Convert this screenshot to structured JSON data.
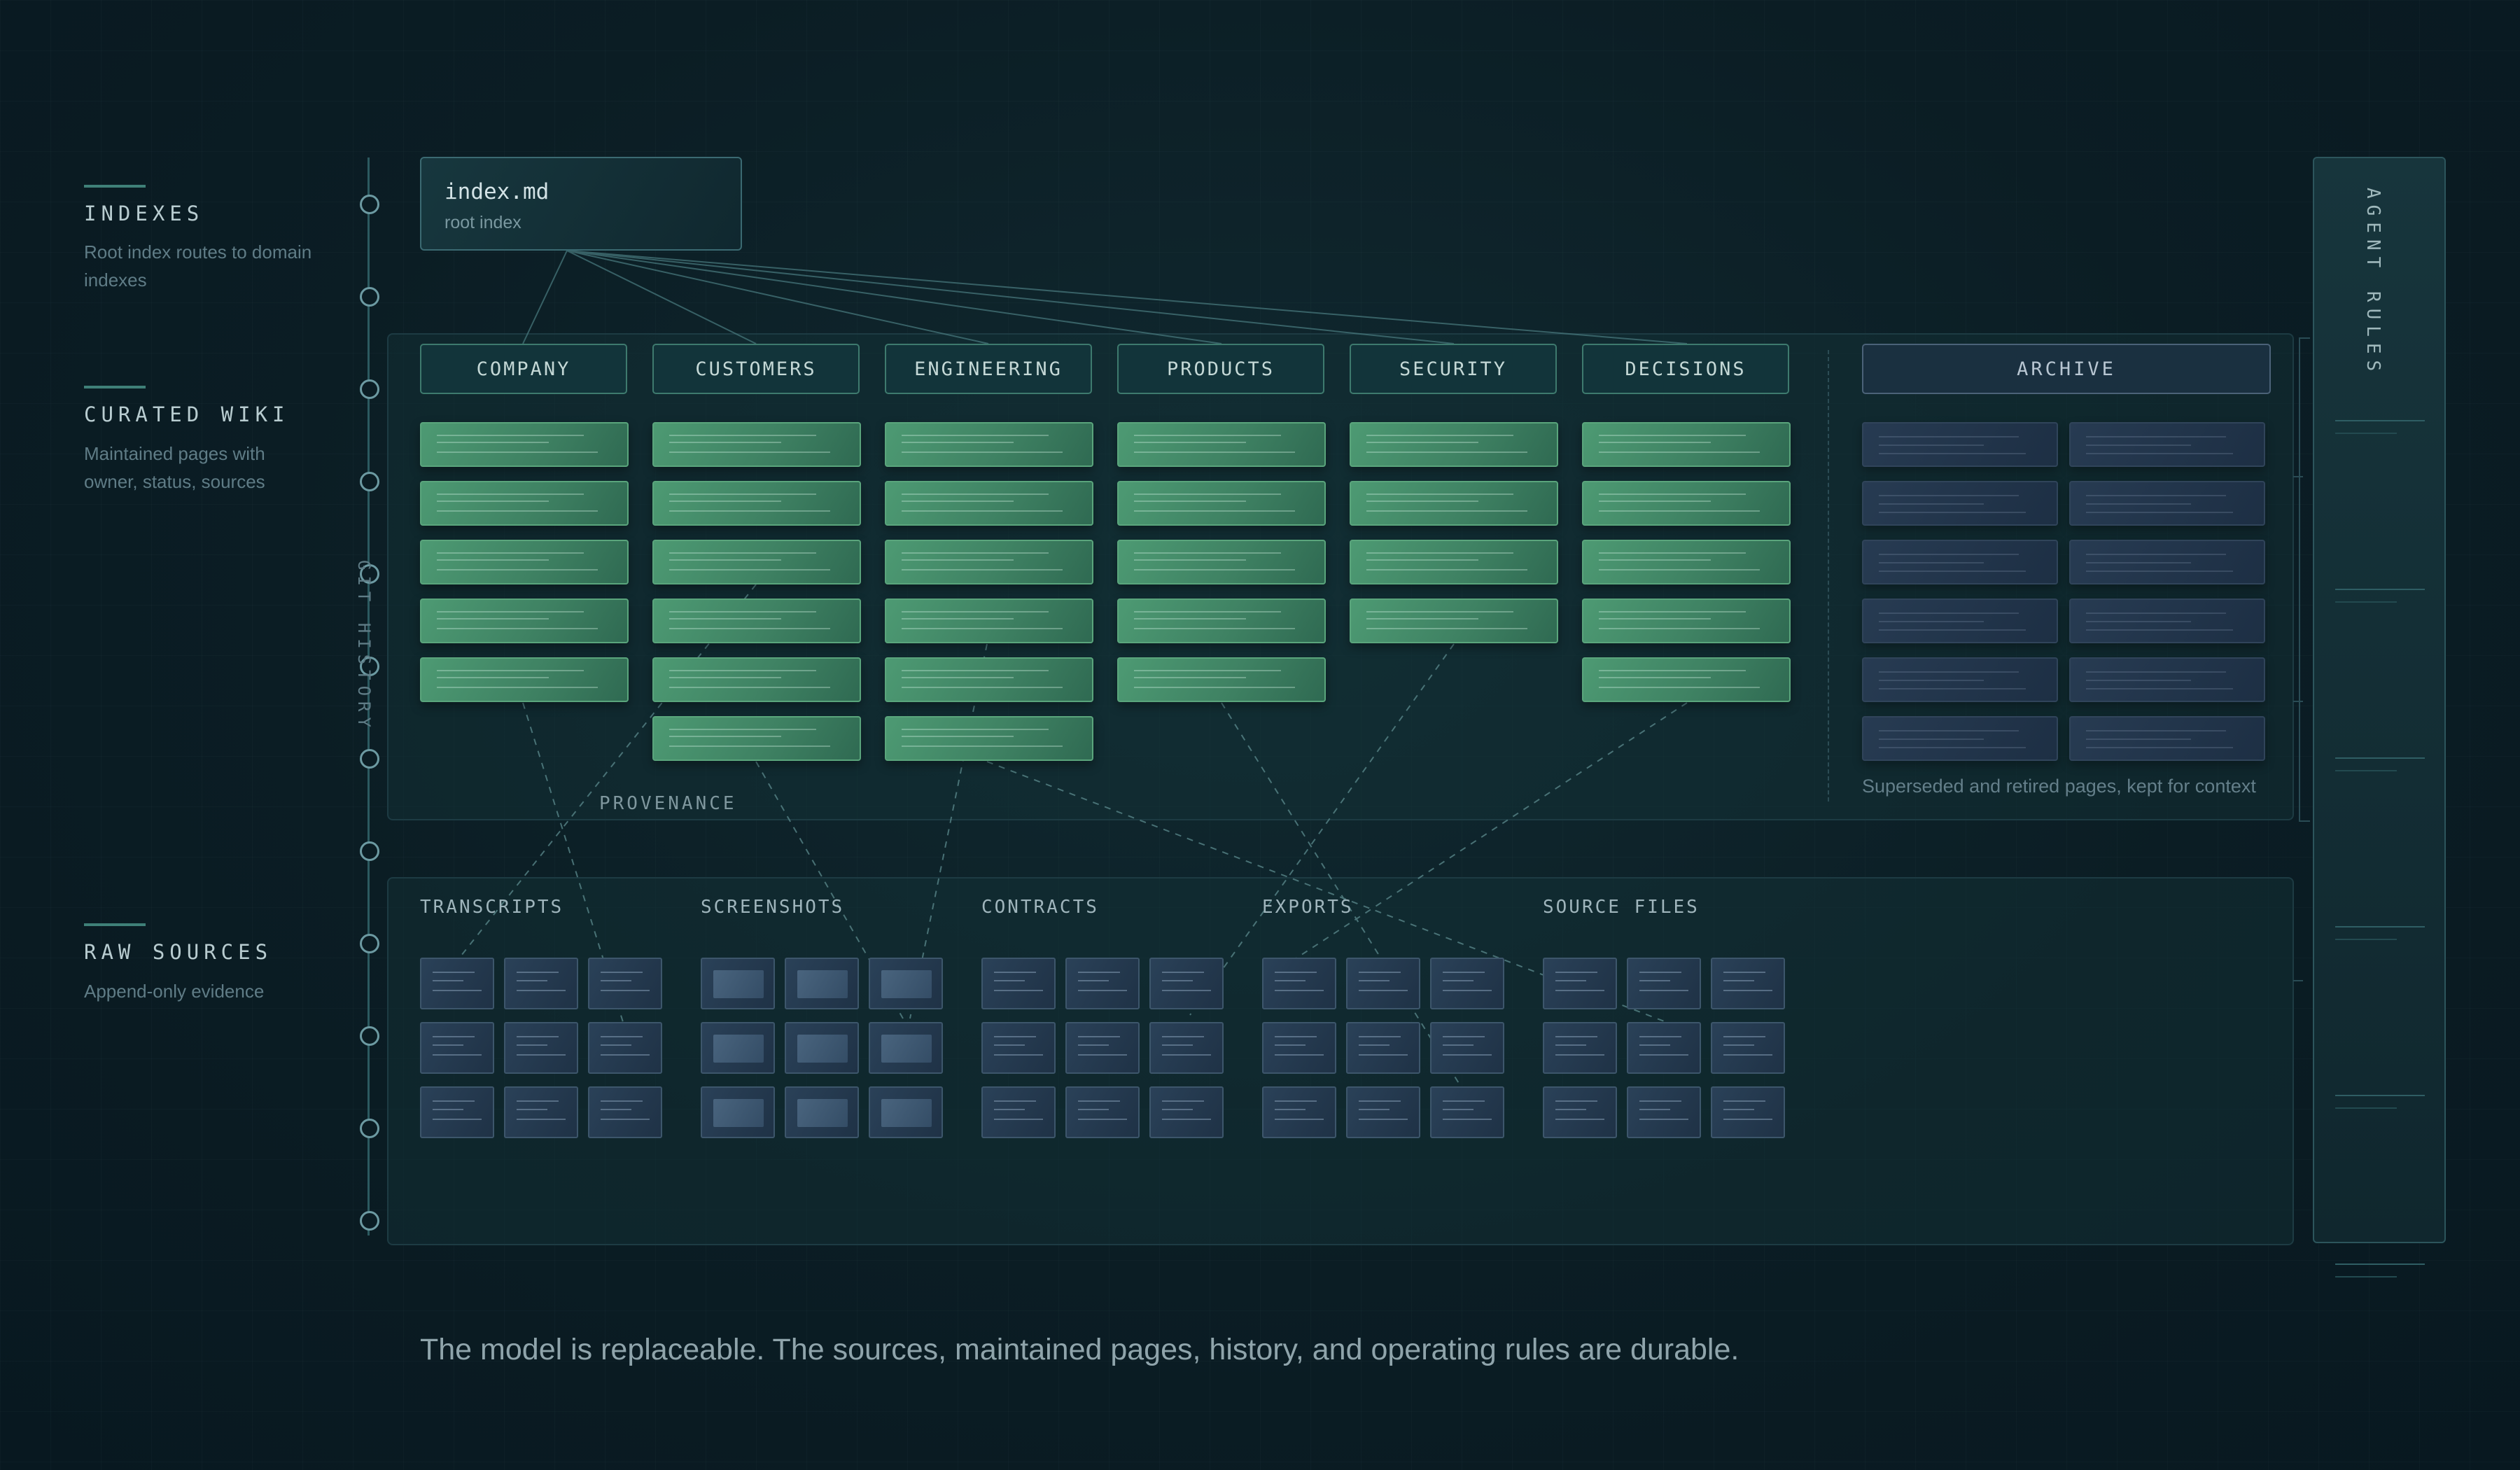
{
  "legend": [
    {
      "title": "INDEXES",
      "desc": "Root index routes to domain indexes"
    },
    {
      "title": "CURATED WIKI",
      "desc": "Maintained pages with owner, status, sources"
    },
    {
      "title": "RAW SOURCES",
      "desc": "Append-only evidence"
    }
  ],
  "git_history_label": "GIT HISTORY",
  "root_index": {
    "title": "index.md",
    "subtitle": "root index"
  },
  "domains": [
    {
      "name": "COMPANY",
      "pages": 5
    },
    {
      "name": "CUSTOMERS",
      "pages": 6
    },
    {
      "name": "ENGINEERING",
      "pages": 6
    },
    {
      "name": "PRODUCTS",
      "pages": 5
    },
    {
      "name": "SECURITY",
      "pages": 4
    },
    {
      "name": "DECISIONS",
      "pages": 5
    }
  ],
  "archive": {
    "name": "ARCHIVE",
    "pages": 12,
    "caption": "Superseded and retired pages, kept for context"
  },
  "provenance_label": "PROVENANCE",
  "sources": [
    {
      "name": "TRANSCRIPTS",
      "kind": "doc"
    },
    {
      "name": "SCREENSHOTS",
      "kind": "image"
    },
    {
      "name": "CONTRACTS",
      "kind": "doc"
    },
    {
      "name": "EXPORTS",
      "kind": "doc"
    },
    {
      "name": "SOURCE FILES",
      "kind": "doc"
    }
  ],
  "agent_rules_label": "AGENT RULES",
  "tagline": "The model is replaceable. The sources, maintained pages, history, and operating rules are durable.",
  "colors": {
    "wiki_page": "#4d9a73",
    "archive_page": "#273b52",
    "source_tile": "#2a4158",
    "background": "#0b1d24",
    "accent_line": "#3f8078"
  }
}
